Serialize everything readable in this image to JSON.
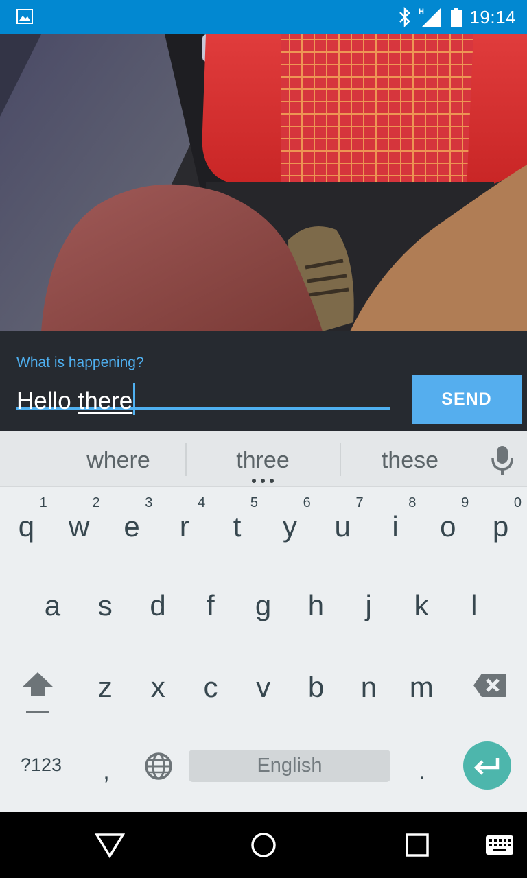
{
  "status_bar": {
    "time": "19:14",
    "network_label": "H",
    "icons": [
      "gallery-notification-icon",
      "bluetooth-icon",
      "cell-signal-icon",
      "battery-icon"
    ]
  },
  "compose": {
    "hint_label": "What is happening?",
    "input_value_committed": "Hello ",
    "input_value_composing": "there",
    "send_label": "SEND"
  },
  "keyboard": {
    "suggestions": [
      "where",
      "three",
      "these"
    ],
    "row1": [
      {
        "letter": "q",
        "hint": "1"
      },
      {
        "letter": "w",
        "hint": "2"
      },
      {
        "letter": "e",
        "hint": "3"
      },
      {
        "letter": "r",
        "hint": "4"
      },
      {
        "letter": "t",
        "hint": "5"
      },
      {
        "letter": "y",
        "hint": "6"
      },
      {
        "letter": "u",
        "hint": "7"
      },
      {
        "letter": "i",
        "hint": "8"
      },
      {
        "letter": "o",
        "hint": "9"
      },
      {
        "letter": "p",
        "hint": "0"
      }
    ],
    "row2": [
      "a",
      "s",
      "d",
      "f",
      "g",
      "h",
      "j",
      "k",
      "l"
    ],
    "row3": [
      "z",
      "x",
      "c",
      "v",
      "b",
      "n",
      "m"
    ],
    "symbols_label": "?123",
    "comma_label": ",",
    "space_label": "English",
    "period_label": "."
  },
  "colors": {
    "status_bar": "#0288d1",
    "accent": "#4fb0f0",
    "send_button": "#55aeee",
    "enter_key": "#4db6ac"
  }
}
